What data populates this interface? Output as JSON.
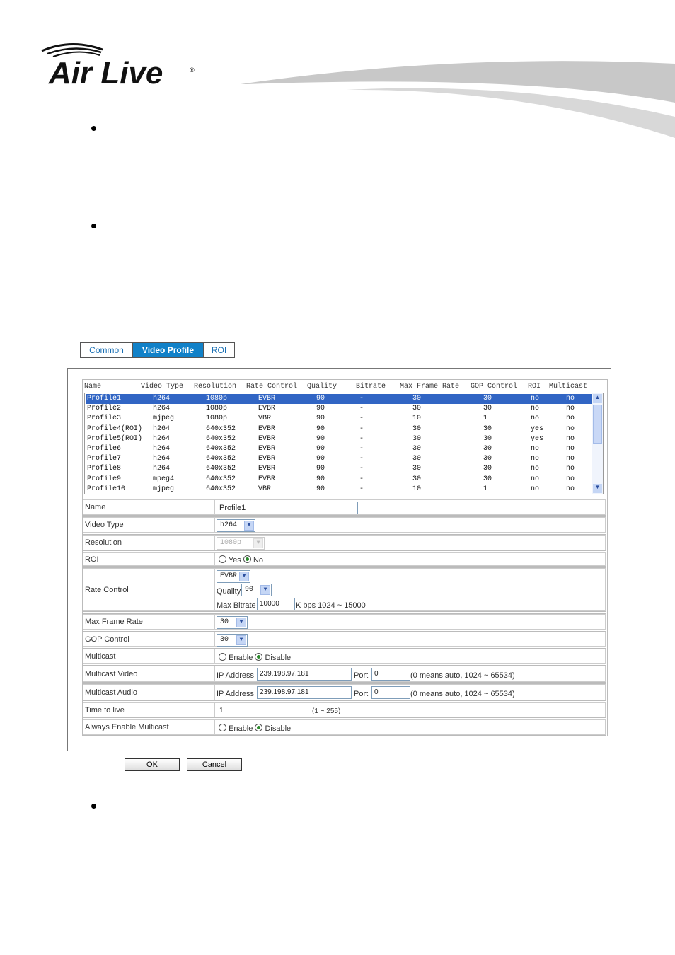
{
  "logo": {
    "text": "Air Live"
  },
  "tabs": [
    {
      "label": "Common",
      "active": false
    },
    {
      "label": "Video Profile",
      "active": true
    },
    {
      "label": "ROI",
      "active": false
    }
  ],
  "table": {
    "columns": [
      "Name",
      "Video Type",
      "Resolution",
      "Rate Control",
      "Quality",
      "Bitrate",
      "Max Frame Rate",
      "GOP Control",
      "ROI",
      "Multicast"
    ],
    "rows": [
      [
        "Profile1",
        "h264",
        "1080p",
        "EVBR",
        "90",
        "-",
        "30",
        "30",
        "no",
        "no"
      ],
      [
        "Profile2",
        "h264",
        "1080p",
        "EVBR",
        "90",
        "-",
        "30",
        "30",
        "no",
        "no"
      ],
      [
        "Profile3",
        "mjpeg",
        "1080p",
        "VBR",
        "90",
        "-",
        "10",
        "1",
        "no",
        "no"
      ],
      [
        "Profile4(ROI)",
        "h264",
        "640x352",
        "EVBR",
        "90",
        "-",
        "30",
        "30",
        "yes",
        "no"
      ],
      [
        "Profile5(ROI)",
        "h264",
        "640x352",
        "EVBR",
        "90",
        "-",
        "30",
        "30",
        "yes",
        "no"
      ],
      [
        "Profile6",
        "h264",
        "640x352",
        "EVBR",
        "90",
        "-",
        "30",
        "30",
        "no",
        "no"
      ],
      [
        "Profile7",
        "h264",
        "640x352",
        "EVBR",
        "90",
        "-",
        "30",
        "30",
        "no",
        "no"
      ],
      [
        "Profile8",
        "h264",
        "640x352",
        "EVBR",
        "90",
        "-",
        "30",
        "30",
        "no",
        "no"
      ],
      [
        "Profile9",
        "mpeg4",
        "640x352",
        "EVBR",
        "90",
        "-",
        "30",
        "30",
        "no",
        "no"
      ],
      [
        "Profile10",
        "mjpeg",
        "640x352",
        "VBR",
        "90",
        "-",
        "10",
        "1",
        "no",
        "no"
      ]
    ],
    "selected_index": 0
  },
  "form": {
    "name": {
      "label": "Name",
      "value": "Profile1"
    },
    "video_type": {
      "label": "Video Type",
      "value": "h264"
    },
    "resolution": {
      "label": "Resolution",
      "value": "1080p"
    },
    "roi": {
      "label": "ROI",
      "yes": "Yes",
      "no": "No",
      "selected": "No"
    },
    "rate_control": {
      "label": "Rate Control",
      "value": "EVBR",
      "quality_label": "Quality",
      "quality": "90",
      "max_bitrate_label": "Max Bitrate",
      "max_bitrate": "10000",
      "bitrate_hint": "K bps 1024 ~ 15000"
    },
    "max_frame_rate": {
      "label": "Max Frame Rate",
      "value": "30"
    },
    "gop_control": {
      "label": "GOP Control",
      "value": "30"
    },
    "multicast": {
      "label": "Multicast",
      "enable": "Enable",
      "disable": "Disable",
      "selected": "Disable"
    },
    "multicast_video": {
      "label": "Multicast Video",
      "ip_label": "IP Address",
      "ip": "239.198.97.181",
      "port_label": "Port",
      "port": "0",
      "hint": "(0 means auto, 1024 ~ 65534)"
    },
    "multicast_audio": {
      "label": "Multicast Audio",
      "ip_label": "IP Address",
      "ip": "239.198.97.181",
      "port_label": "Port",
      "port": "0",
      "hint": "(0 means auto, 1024 ~ 65534)"
    },
    "ttl": {
      "label": "Time to live",
      "value": "1",
      "hint": "(1 ~ 255)"
    },
    "always_multicast": {
      "label": "Always Enable Multicast",
      "enable": "Enable",
      "disable": "Disable",
      "selected": "Disable"
    }
  },
  "buttons": {
    "ok": "OK",
    "cancel": "Cancel"
  },
  "colors": {
    "tab_active": "#1181c8",
    "selected_row": "#3165c4",
    "tab_text": "#1a6fb3"
  }
}
